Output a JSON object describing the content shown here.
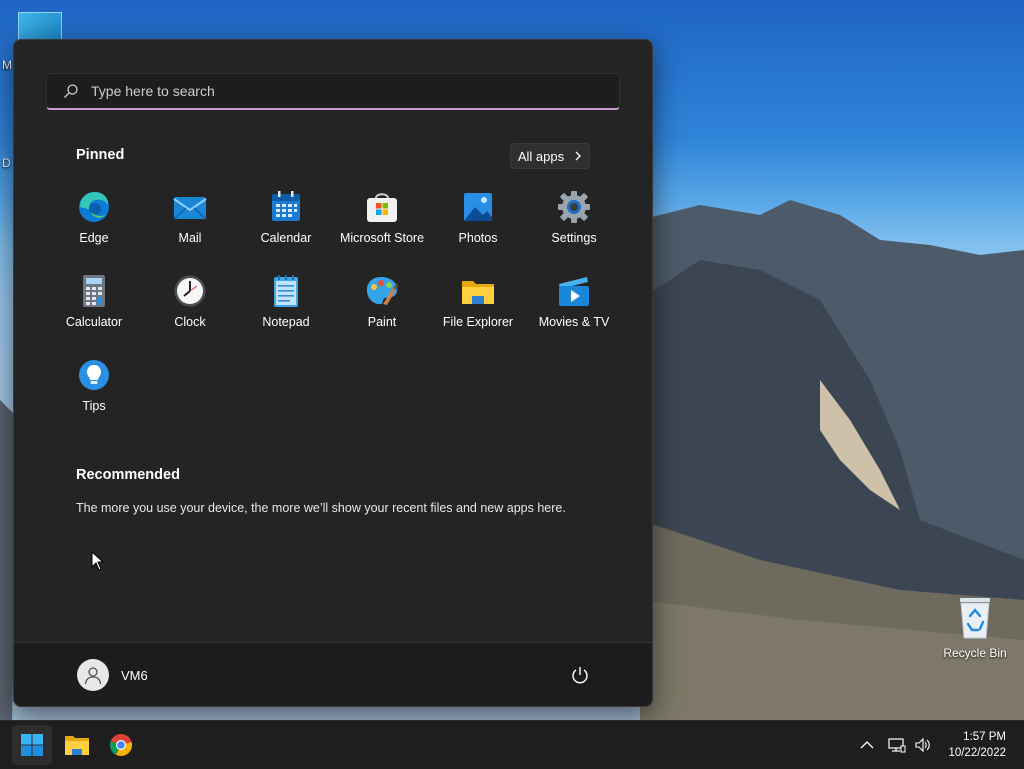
{
  "desktop": {
    "edge_letters": [
      "M",
      "D"
    ],
    "recycle_bin_label": "Recycle Bin"
  },
  "start_menu": {
    "search": {
      "placeholder": "Type here to search",
      "value": ""
    },
    "pinned": {
      "title": "Pinned",
      "all_apps_label": "All apps",
      "apps": [
        {
          "label": "Edge",
          "icon": "edge-icon"
        },
        {
          "label": "Mail",
          "icon": "mail-icon"
        },
        {
          "label": "Calendar",
          "icon": "calendar-icon"
        },
        {
          "label": "Microsoft Store",
          "icon": "store-icon"
        },
        {
          "label": "Photos",
          "icon": "photos-icon"
        },
        {
          "label": "Settings",
          "icon": "gear-icon"
        },
        {
          "label": "Calculator",
          "icon": "calculator-icon"
        },
        {
          "label": "Clock",
          "icon": "clock-icon"
        },
        {
          "label": "Notepad",
          "icon": "notepad-icon"
        },
        {
          "label": "Paint",
          "icon": "paint-icon"
        },
        {
          "label": "File Explorer",
          "icon": "folder-icon"
        },
        {
          "label": "Movies & TV",
          "icon": "movies-icon"
        },
        {
          "label": "Tips",
          "icon": "lightbulb-icon"
        }
      ]
    },
    "recommended": {
      "title": "Recommended",
      "empty_text": "The more you use your device, the more we’ll show your recent files and new apps here."
    },
    "footer": {
      "user_name": "VM6"
    }
  },
  "taskbar": {
    "apps": [
      "start-icon",
      "folder-icon",
      "chrome-icon"
    ],
    "clock": {
      "time": "1:57 PM",
      "date": "10/22/2022"
    }
  },
  "colors": {
    "menu_bg": "#242424",
    "accent_search": "#c79bd1",
    "taskbar_bg": "#1e1e1e"
  }
}
